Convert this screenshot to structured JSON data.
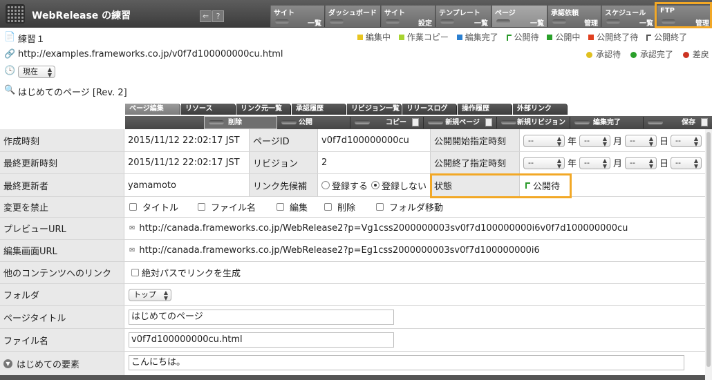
{
  "app": {
    "title": "WebRelease の練習"
  },
  "toolbar_icons": [
    {
      "name": "back-icon",
      "glyph": "⇐"
    },
    {
      "name": "help-icon",
      "glyph": "?"
    }
  ],
  "menu": [
    {
      "top": "サイト",
      "bottom": "一覧"
    },
    {
      "top": "ダッシュボード",
      "bottom": ""
    },
    {
      "top": "サイト",
      "bottom": "設定"
    },
    {
      "top": "テンプレート",
      "bottom": "一覧"
    },
    {
      "top": "ページ",
      "bottom": "一覧"
    },
    {
      "top": "承認依頼",
      "bottom": "管理"
    },
    {
      "top": "スケジュール",
      "bottom": "一覧"
    },
    {
      "top": "FTP",
      "bottom": "管理"
    }
  ],
  "page": {
    "site_name": "練習１",
    "url": "http://examples.frameworks.co.jp/v0f7d100000000cu.html",
    "time_select": "現在",
    "page_title_rev": "はじめてのページ [Rev. 2]"
  },
  "status_legend": [
    {
      "label": "編集中",
      "color": "#e8c520",
      "shape": "square"
    },
    {
      "label": "作業コピー",
      "color": "#a8d430",
      "shape": "square"
    },
    {
      "label": "編集完了",
      "color": "#2a7fd0",
      "shape": "square"
    },
    {
      "label": "公開待",
      "color": "#2a9a2a",
      "shape": "flag"
    },
    {
      "label": "公開中",
      "color": "#2aa02a",
      "shape": "square"
    },
    {
      "label": "公開終了待",
      "color": "#e04020",
      "shape": "square"
    },
    {
      "label": "公開終了",
      "color": "#555555",
      "shape": "flag"
    }
  ],
  "approve_legend": [
    {
      "label": "承認待",
      "color": "#e0c020"
    },
    {
      "label": "承認完了",
      "color": "#2aa02a"
    },
    {
      "label": "差戻",
      "color": "#cc3322"
    }
  ],
  "tabs": [
    "ページ編集",
    "リソース",
    "リンク元一覧",
    "承認履歴",
    "リビジョン一覧",
    "リリースログ",
    "操作履歴",
    "外部リンク"
  ],
  "actions": [
    "削除",
    "公開",
    "コピー",
    "新規ページ",
    "新規リビジョン",
    "編集完了",
    "保存"
  ],
  "form": {
    "created_label": "作成時刻",
    "created_value": "2015/11/12 22:02:17 JST",
    "page_id_label": "ページID",
    "page_id_value": "v0f7d100000000cu",
    "pub_start_label": "公開開始指定時刻",
    "updated_label": "最終更新時刻",
    "updated_value": "2015/11/12 22:02:17 JST",
    "revision_label": "リビジョン",
    "revision_value": "2",
    "pub_end_label": "公開終了指定時刻",
    "date_placeholder": "--",
    "unit_year": "年",
    "unit_month": "月",
    "unit_day": "日",
    "updater_label": "最終更新者",
    "updater_value": "yamamoto",
    "link_candidate_label": "リンク先候補",
    "radio_register": "登録する",
    "radio_no_register": "登録しない",
    "state_label": "状態",
    "state_value": "公開待",
    "lock_label": "変更を禁止",
    "lock_options": [
      "タイトル",
      "ファイル名",
      "編集",
      "削除",
      "フォルダ移動"
    ],
    "preview_url_label": "プレビューURL",
    "preview_url_value": "http://canada.frameworks.co.jp/WebRelease2?p=Vg1css2000000003sv0f7d100000000i6v0f7d100000000cu",
    "edit_url_label": "編集画面URL",
    "edit_url_value": "http://canada.frameworks.co.jp/WebRelease2?p=Eg1css2000000003sv0f7d100000000i6",
    "other_link_label": "他のコンテンツへのリンク",
    "other_link_option": "絶対パスでリンクを生成",
    "folder_label": "フォルダ",
    "folder_value": "トップ",
    "page_title_label": "ページタイトル",
    "page_title_value": "はじめてのページ",
    "file_name_label": "ファイル名",
    "file_name_value": "v0f7d100000000cu.html",
    "element_label": "はじめての要素",
    "element_value": "こんにちは。"
  }
}
